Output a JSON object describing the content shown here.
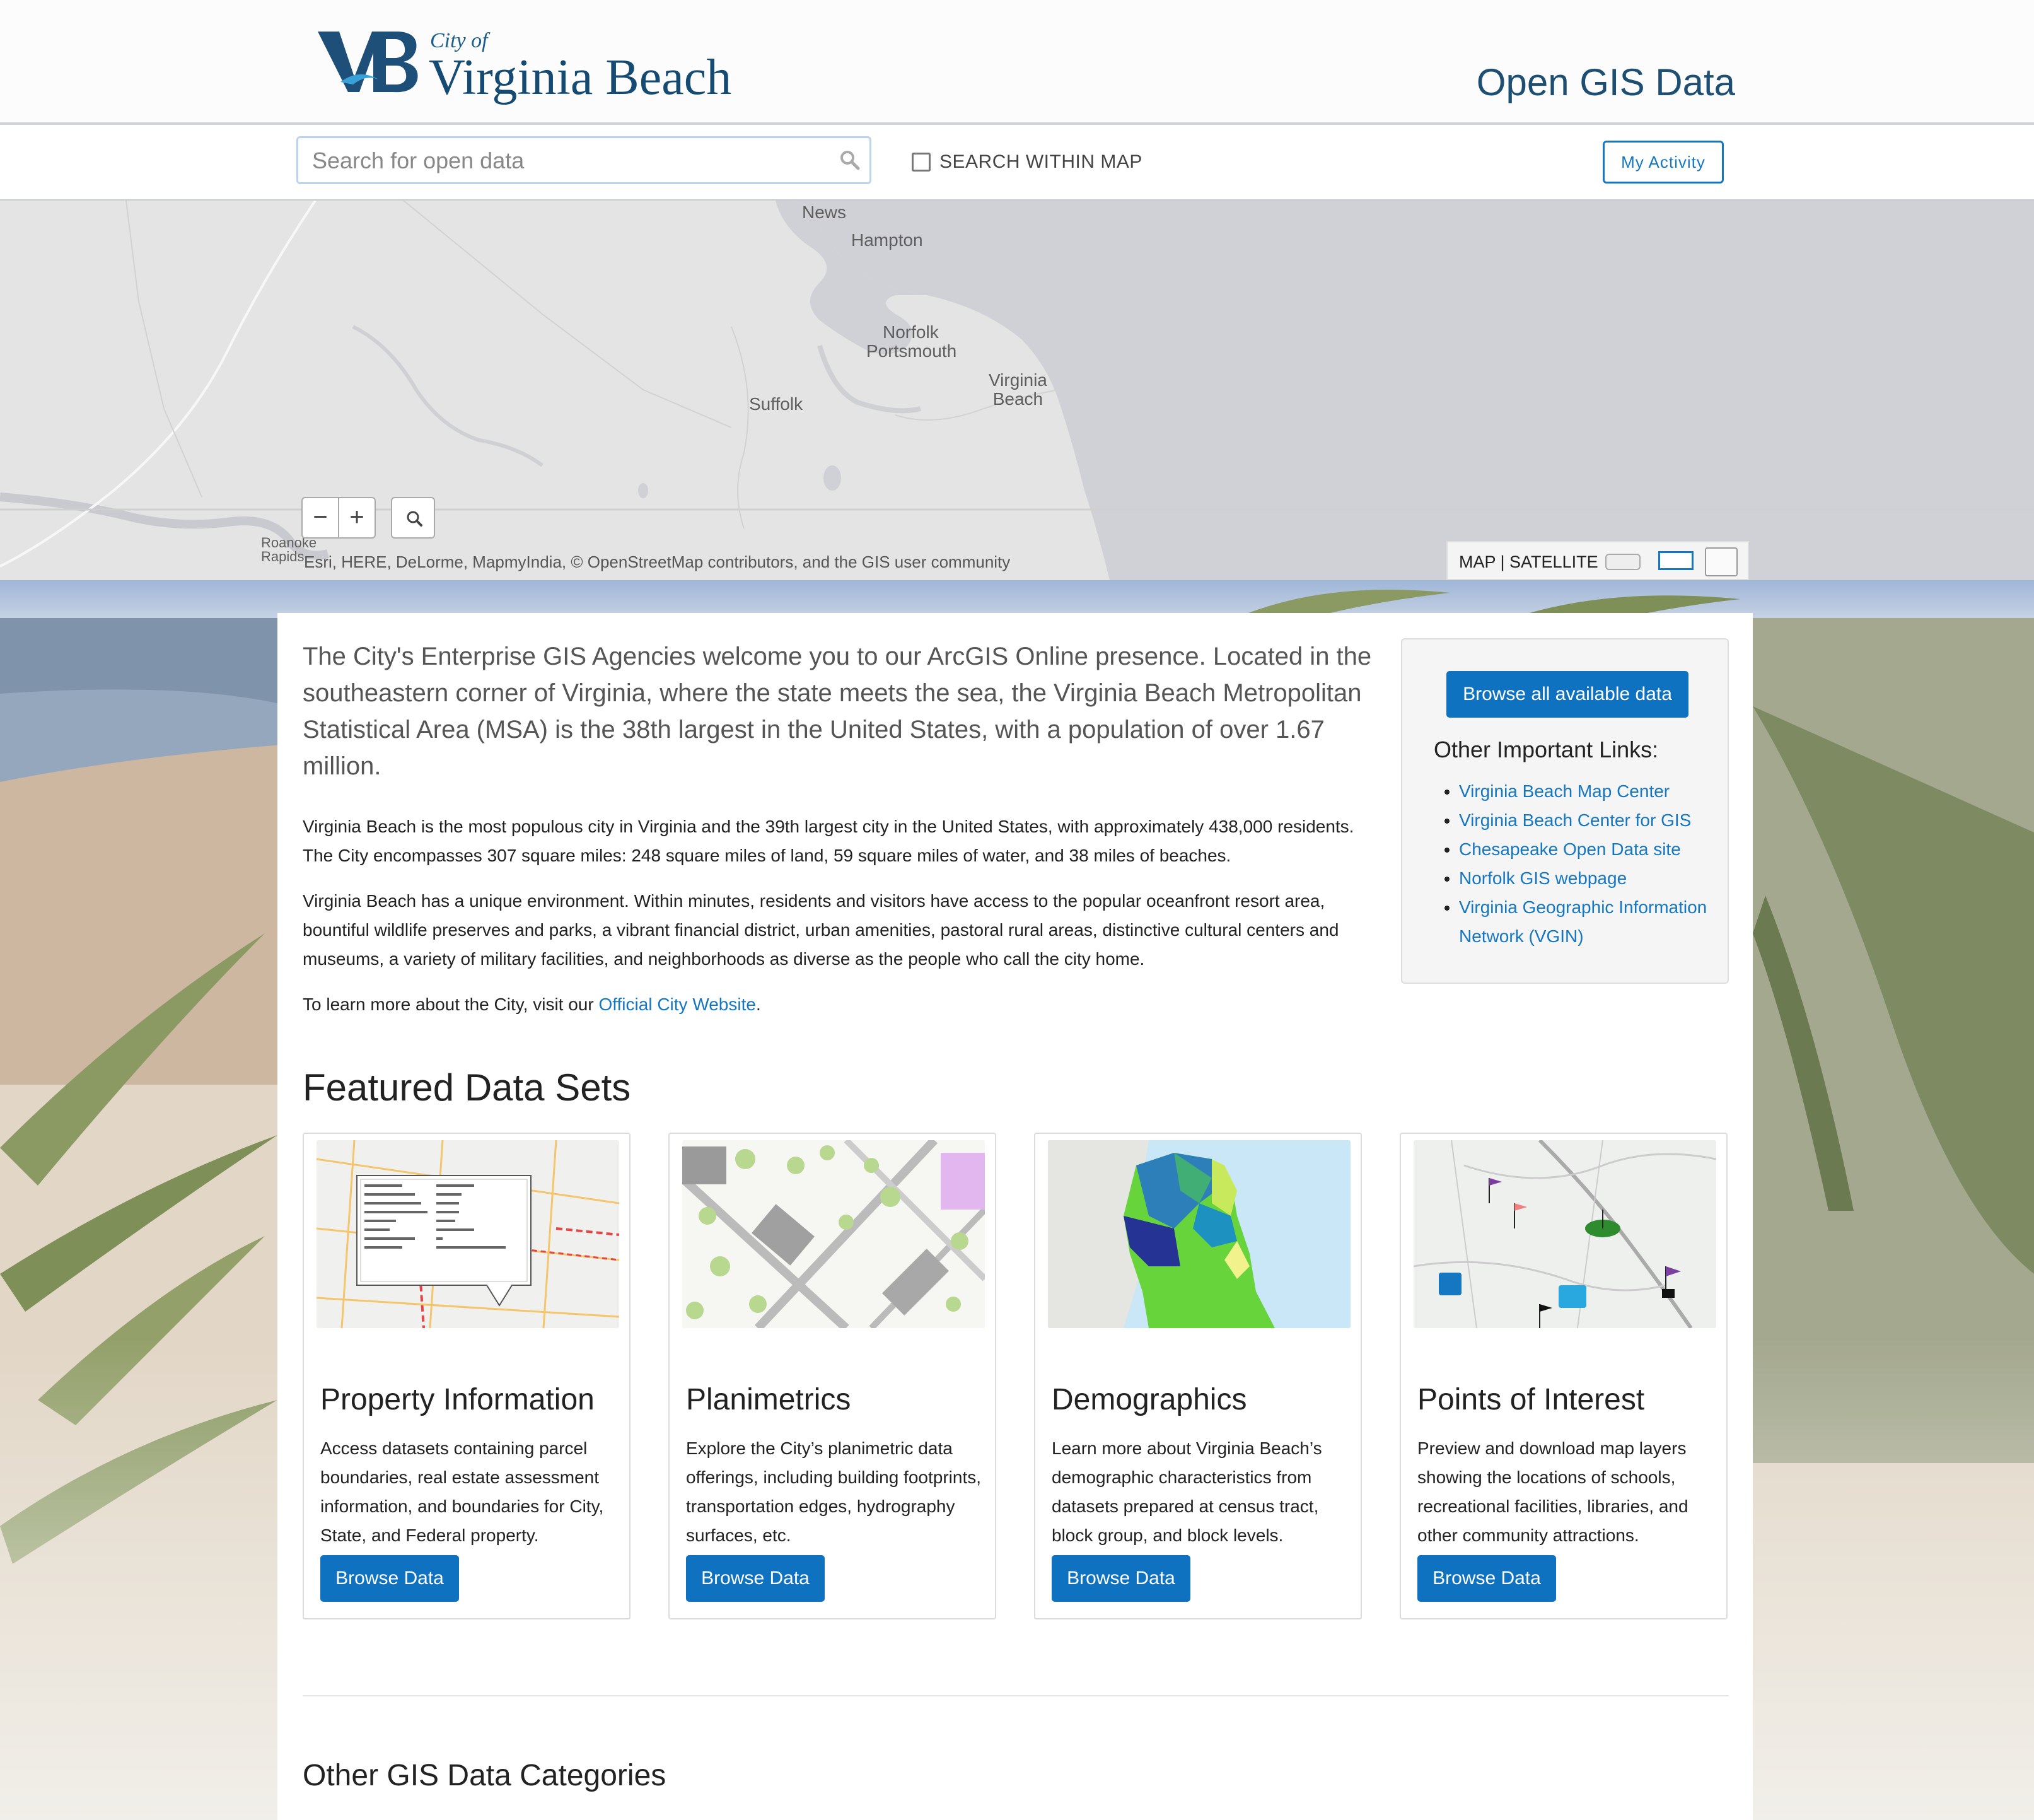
{
  "header": {
    "logo_small": "City of",
    "logo_big": "Virginia Beach",
    "site_title": "Open GIS Data"
  },
  "search": {
    "placeholder": "Search for open data",
    "within_map_label": "SEARCH WITHIN MAP",
    "my_activity_label": "My Activity"
  },
  "map": {
    "labels": {
      "news": "News",
      "hampton": "Hampton",
      "norfolk": "Norfolk",
      "portsmouth": "Portsmouth",
      "virginia_beach": "Virginia\nBeach",
      "suffolk": "Suffolk",
      "roanoke": "Roanoke\nRapids"
    },
    "zoom_out": "−",
    "zoom_in": "+",
    "attribution": "Esri, HERE, DeLorme, MapmyIndia, © OpenStreetMap contributors, and the GIS user community",
    "basemap_label": "MAP | SATELLITE"
  },
  "intro": {
    "lead": "The City's Enterprise GIS Agencies welcome you to our ArcGIS Online presence. Located in the southeastern corner of Virginia, where the state meets the sea, the Virginia Beach Metropolitan Statistical Area (MSA) is the 38th largest in the United States, with a population of over 1.67 million.",
    "p1": "Virginia Beach is the most populous city in Virginia and the 39th largest city in the United States, with approximately 438,000 residents. The City encompasses 307 square miles: 248 square miles of land, 59 square miles of water, and 38 miles of beaches.",
    "p2": "Virginia Beach has a unique environment. Within minutes, residents and visitors have access to the popular oceanfront resort area, bountiful wildlife preserves and parks, a vibrant financial district, urban amenities, pastoral rural areas, distinctive cultural centers and museums, a variety of military facilities, and neighborhoods as diverse as the people who call the city home.",
    "p3_prefix": "To learn more about the City, visit our ",
    "p3_link": "Official City Website",
    "p3_suffix": "."
  },
  "sidebar": {
    "browse_all": "Browse all available data",
    "title": "Other Important Links:",
    "links": [
      "Virginia Beach Map Center",
      "Virginia Beach Center for GIS",
      "Chesapeake Open Data site",
      "Norfolk GIS webpage",
      "Virginia Geographic Information Network (VGIN)"
    ]
  },
  "featured": {
    "title": "Featured Data Sets",
    "cards": [
      {
        "title": "Property Information",
        "desc": "Access datasets containing parcel boundaries, real estate assessment information, and boundaries for City, State, and Federal property.",
        "button": "Browse Data"
      },
      {
        "title": "Planimetrics",
        "desc": "Explore the City’s planimetric data offerings, including building footprints, transportation edges, hydrography surfaces, etc.",
        "button": "Browse Data"
      },
      {
        "title": "Demographics",
        "desc": "Learn more about Virginia Beach’s demographic characteristics from datasets prepared at census tract, block group, and block levels.",
        "button": "Browse Data"
      },
      {
        "title": "Points of Interest",
        "desc": "Preview and download map layers showing the locations of schools, recreational facilities, libraries, and other community attractions.",
        "button": "Browse Data"
      }
    ]
  },
  "other": {
    "title": "Other GIS Data Categories"
  }
}
